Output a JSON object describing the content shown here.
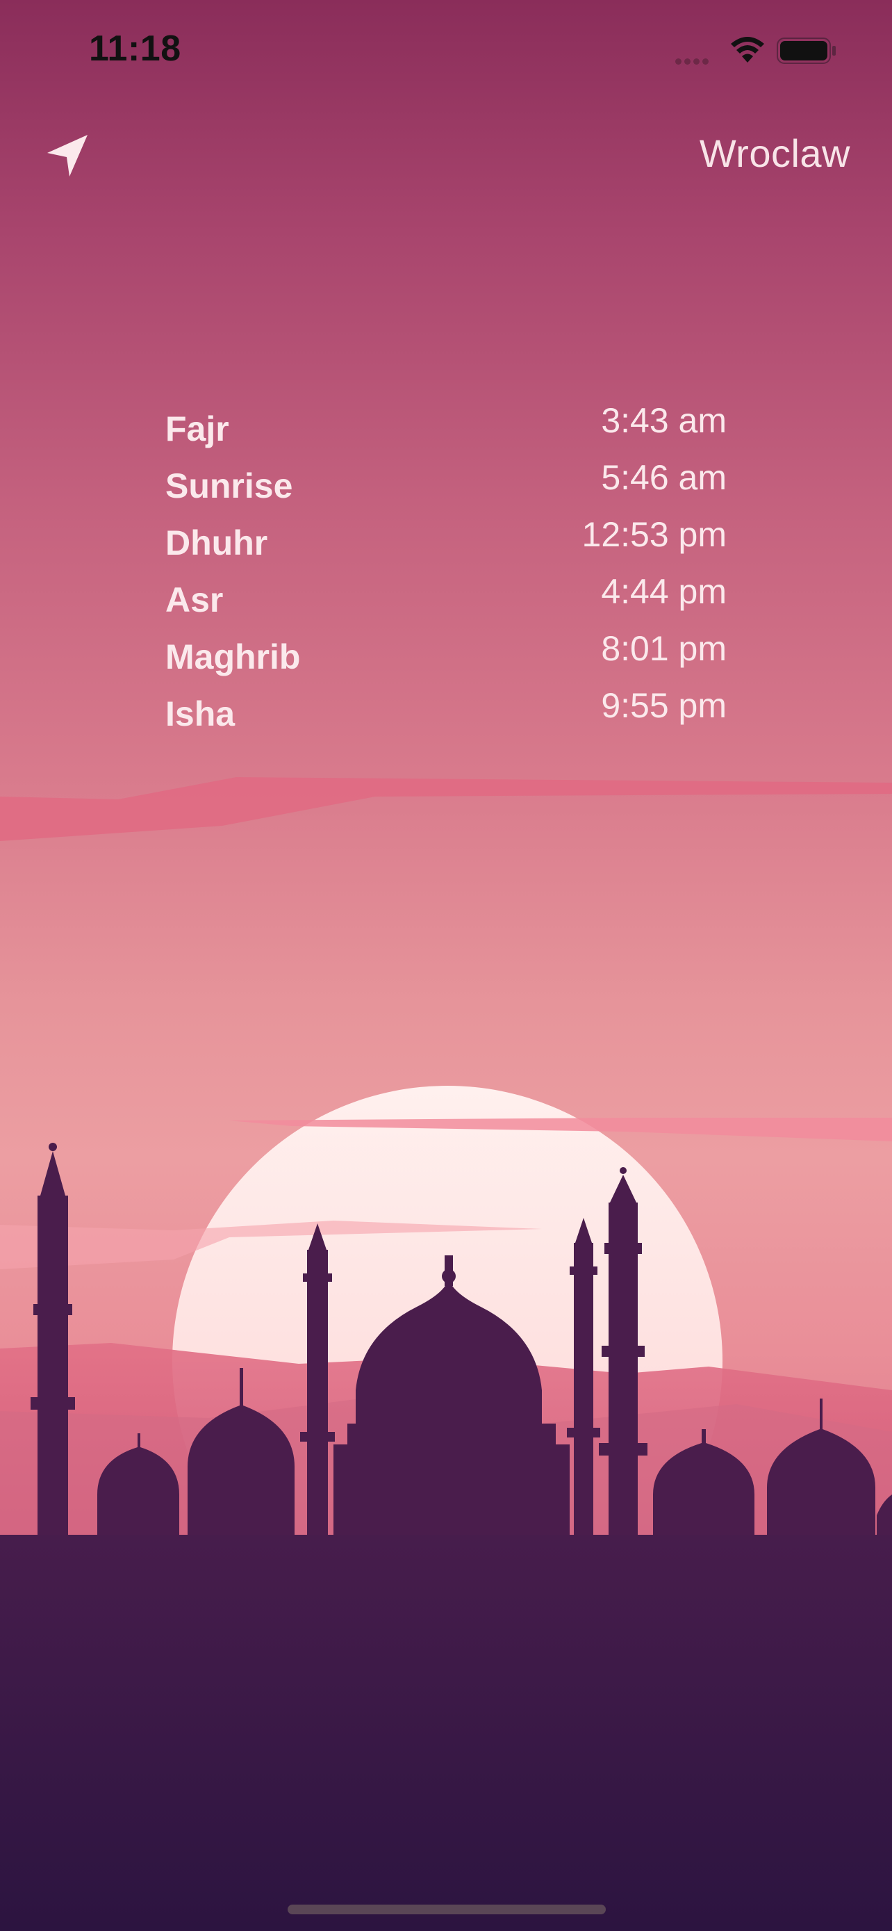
{
  "status_bar": {
    "time": "11:18",
    "icons": [
      "cellular-signal-icon",
      "wifi-icon",
      "battery-icon"
    ]
  },
  "header": {
    "location_icon": "location-arrow-icon",
    "city": "Wroclaw"
  },
  "prayers": [
    {
      "name": "Fajr",
      "time": "3:43 am"
    },
    {
      "name": "Sunrise",
      "time": "5:46 am"
    },
    {
      "name": "Dhuhr",
      "time": "12:53 pm"
    },
    {
      "name": "Asr",
      "time": "4:44 pm"
    },
    {
      "name": "Maghrib",
      "time": "8:01 pm"
    },
    {
      "name": "Isha",
      "time": "9:55 pm"
    }
  ],
  "colors": {
    "sky_top": "#8a2d5a",
    "sky_mid": "#d87a8c",
    "sky_low": "#ec9ea2",
    "sun": "#ffe4e4",
    "silhouette": "#4a1d4c",
    "ground_bottom": "#2e1540",
    "text": "#fbe9ec"
  }
}
